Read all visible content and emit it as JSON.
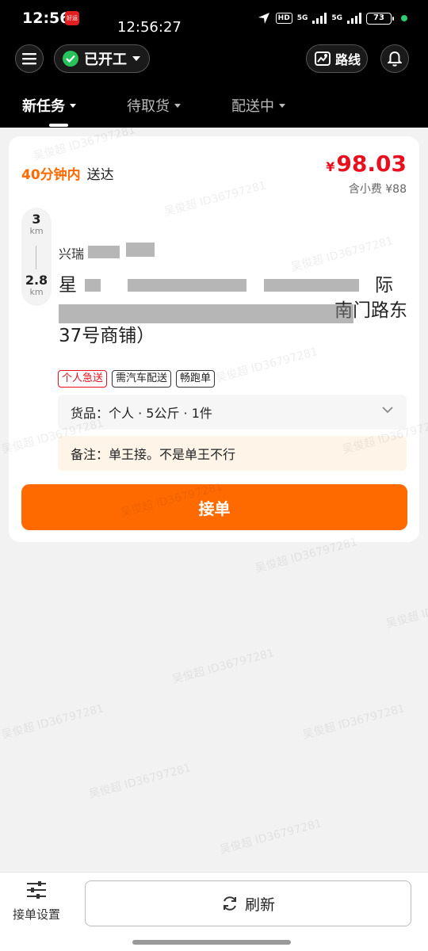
{
  "status_bar": {
    "time": "12:56",
    "app_badge": "好运",
    "overlay_time": "12:56:27",
    "hd": "HD",
    "signal_1": "5G",
    "signal_2": "5G",
    "battery": "73"
  },
  "toolbar": {
    "work_status": "已开工",
    "route_label": "路线"
  },
  "tabs": [
    {
      "label": "新任务",
      "active": true
    },
    {
      "label": "待取货",
      "active": false
    },
    {
      "label": "配送中",
      "active": false
    }
  ],
  "order": {
    "eta_time": "40分钟内",
    "eta_label": "送达",
    "price_symbol": "¥",
    "price": "98.03",
    "tip": "含小费 ¥88",
    "distance_1_value": "3",
    "distance_1_unit": "km",
    "distance_2_value": "2.8",
    "distance_2_unit": "km",
    "pickup": "兴瑞",
    "address_line_1": "星",
    "address_line_1_end": "际",
    "address_line_2_end": "南门路东",
    "address_line_3": "37号商铺）",
    "tags": [
      "个人急送",
      "需汽车配送",
      "畅跑单"
    ],
    "goods": "货品：个人 · 5公斤 · 1件",
    "remark": "备注：单王接。不是单王不行",
    "accept_label": "接单"
  },
  "watermark": "吴俊超 ID36797281",
  "bottom": {
    "settings_label": "接单设置",
    "refresh_label": "刷新"
  },
  "colors": {
    "accent": "#ff6a00",
    "price": "#e8101e",
    "work_status": "#27c25a"
  }
}
